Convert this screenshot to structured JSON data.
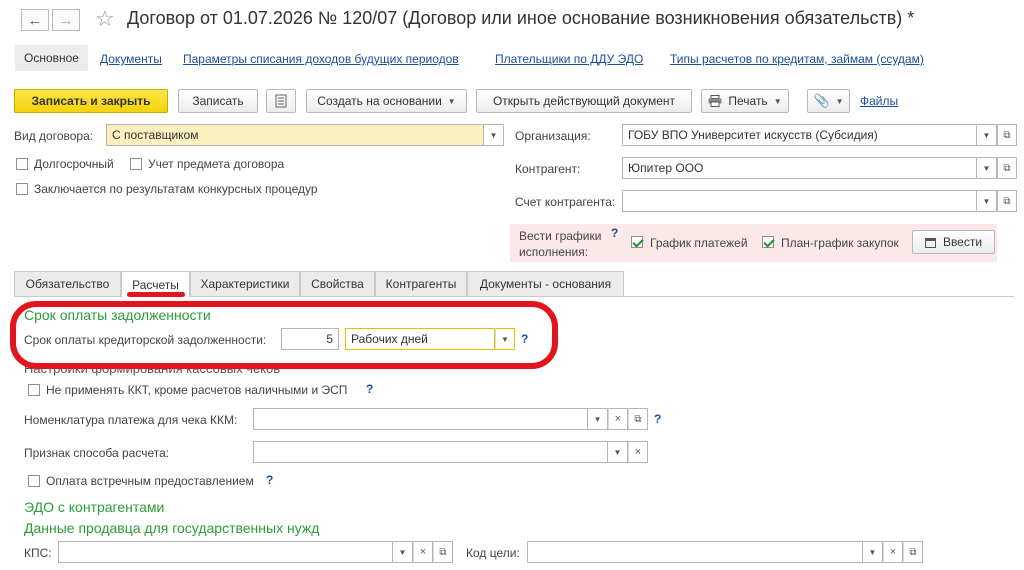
{
  "window": {
    "title": "Договор от 01.07.2026 № 120/07 (Договор или иное основание возникновения обязательств) *"
  },
  "nav_links": [
    {
      "label": "Основное"
    },
    {
      "label": "Документы"
    },
    {
      "label": "Параметры списания доходов будущих периодов"
    },
    {
      "label": "Плательщики по ДДУ ЭДО"
    },
    {
      "label": "Типы расчетов по кредитам, займам (ссудам)"
    }
  ],
  "toolbar": {
    "save_close": "Записать и закрыть",
    "save": "Записать",
    "create_based": "Создать на основании",
    "open_current": "Открыть действующий документ",
    "print": "Печать",
    "files": "Файлы"
  },
  "form": {
    "contract_type_label": "Вид договора:",
    "contract_type_value": "С поставщиком",
    "longterm_label": "Долгосрочный",
    "subject_label": "Учет предмета договора",
    "tender_label": "Заключается по результатам конкурсных процедур",
    "org_label": "Организация:",
    "org_value": "ГОБУ ВПО Университет искусств (Субсидия)",
    "counterparty_label": "Контрагент:",
    "counterparty_value": "Юпитер ООО",
    "account_label": "Счет контрагента:",
    "account_value": "",
    "schedules_label_1": "Вести графики",
    "schedules_label_2": "исполнения:",
    "payment_schedule_label": "График платежей",
    "purchase_plan_label": "План-график закупок",
    "enter_button": "Ввести"
  },
  "tabs": [
    {
      "label": "Обязательство"
    },
    {
      "label": "Расчеты"
    },
    {
      "label": "Характеристики"
    },
    {
      "label": "Свойства"
    },
    {
      "label": "Контрагенты"
    },
    {
      "label": "Документы - основания"
    }
  ],
  "payment_terms": {
    "heading": "Срок оплаты задолженности",
    "creditor_label": "Срок оплаты кредиторской задолженности:",
    "creditor_value": "5",
    "days_type": "Рабочих дней"
  },
  "receipt_settings": {
    "heading": "Настройки формирования кассовых чеков",
    "no_kkt_label": "Не применять ККТ, кроме расчетов наличными и ЭСП",
    "nomenclature_label": "Номенклатура платежа для чека ККМ:",
    "nomenclature_value": "",
    "payment_method_label": "Признак способа расчета:",
    "payment_method_value": "",
    "counter_provision_label": "Оплата встречным предоставлением"
  },
  "edo": {
    "heading": "ЭДО с контрагентами",
    "gov_heading": "Данные продавца для государственных нужд",
    "kps_label": "КПС:",
    "kps_value": "",
    "goal_code_label": "Код цели:",
    "goal_code_value": ""
  },
  "colors": {
    "primary_button": "#f4d20a",
    "link": "#1a4f9e",
    "section_heading": "#2a9d3a",
    "annotation_red": "#e2141c",
    "highlight_field": "#fcf0bf"
  }
}
